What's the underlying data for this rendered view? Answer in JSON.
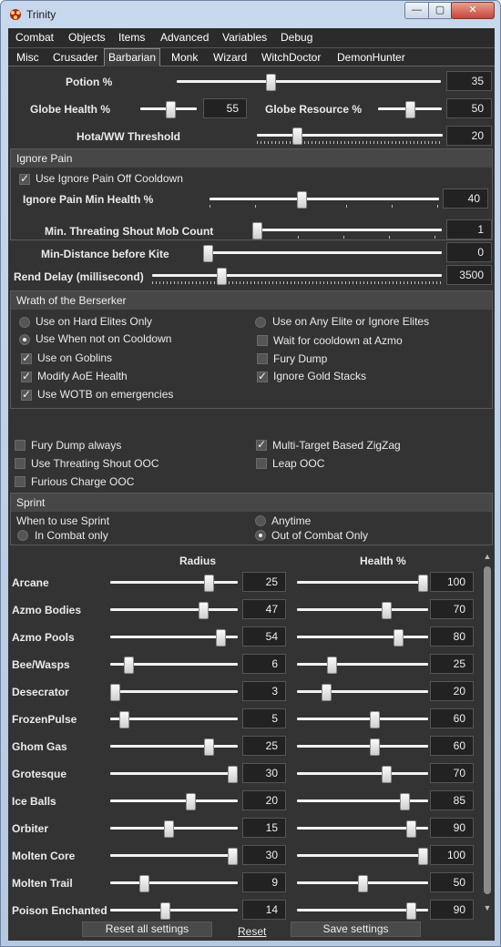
{
  "window": {
    "title": "Trinity"
  },
  "menu": [
    "Combat",
    "Objects",
    "Items",
    "Advanced",
    "Variables",
    "Debug"
  ],
  "tabs": [
    "Misc",
    "Crusader",
    "Barbarian",
    "Monk",
    "Wizard",
    "WitchDoctor",
    "DemonHunter"
  ],
  "active_tab": "Barbarian",
  "potion": {
    "label": "Potion %",
    "value": "35"
  },
  "globe_health": {
    "label": "Globe Health %",
    "value": "55"
  },
  "globe_resource": {
    "label": "Globe Resource %",
    "value": "50"
  },
  "hota": {
    "label": "Hota/WW Threshold",
    "value": "20"
  },
  "ignore_pain": {
    "header": "Ignore Pain",
    "use_off_cooldown": "Use Ignore Pain Off Cooldown",
    "min_health_label": "Ignore Pain Min Health %",
    "min_health_value": "40"
  },
  "threat_shout": {
    "label": "Min. Threating Shout Mob Count",
    "value": "1"
  },
  "kite": {
    "label": "Min-Distance before Kite",
    "value": "0"
  },
  "rend": {
    "label": "Rend Delay (millisecond)",
    "value": "3500"
  },
  "wotb": {
    "header": "Wrath of the Berserker",
    "hard_elites": "Use on Hard Elites Only",
    "any_elite": "Use on Any Elite or Ignore Elites",
    "not_on_cooldown": "Use When not on Cooldown",
    "wait_azmo": "Wait for cooldown at Azmo",
    "goblins": "Use on Goblins",
    "fury_dump": "Fury Dump",
    "modify_aoe": "Modify AoE Health",
    "ignore_gold": "Ignore Gold Stacks",
    "emergencies": "Use WOTB on emergencies"
  },
  "misc_checks": {
    "fury_dump_always": "Fury Dump always",
    "multi_target": "Multi-Target Based ZigZag",
    "threat_shout_ooc": "Use Threating Shout OOC",
    "leap_ooc": "Leap OOC",
    "furious_charge_ooc": "Furious Charge OOC"
  },
  "sprint": {
    "header": "Sprint",
    "when_label": "When to use Sprint",
    "anytime": "Anytime",
    "in_combat": "In Combat only",
    "out_of_combat": "Out of Combat Only"
  },
  "avoid": {
    "radius_header": "Radius",
    "health_header": "Health %",
    "rows": [
      {
        "name": "Arcane",
        "radius": "25",
        "health": "100",
        "rf": 0.8,
        "hf": 1.0
      },
      {
        "name": "Azmo Bodies",
        "radius": "47",
        "health": "70",
        "rf": 0.75,
        "hf": 0.7
      },
      {
        "name": "Azmo Pools",
        "radius": "54",
        "health": "80",
        "rf": 0.9,
        "hf": 0.8
      },
      {
        "name": "Bee/Wasps",
        "radius": "6",
        "health": "25",
        "rf": 0.12,
        "hf": 0.25
      },
      {
        "name": "Desecrator",
        "radius": "3",
        "health": "20",
        "rf": 0.0,
        "hf": 0.2
      },
      {
        "name": "FrozenPulse",
        "radius": "5",
        "health": "60",
        "rf": 0.08,
        "hf": 0.6
      },
      {
        "name": "Ghom Gas",
        "radius": "25",
        "health": "60",
        "rf": 0.8,
        "hf": 0.6
      },
      {
        "name": "Grotesque",
        "radius": "30",
        "health": "70",
        "rf": 1.0,
        "hf": 0.7
      },
      {
        "name": "Ice Balls",
        "radius": "20",
        "health": "85",
        "rf": 0.64,
        "hf": 0.85
      },
      {
        "name": "Orbiter",
        "radius": "15",
        "health": "90",
        "rf": 0.46,
        "hf": 0.9
      },
      {
        "name": "Molten Core",
        "radius": "30",
        "health": "100",
        "rf": 1.0,
        "hf": 1.0
      },
      {
        "name": "Molten Trail",
        "radius": "9",
        "health": "50",
        "rf": 0.25,
        "hf": 0.5
      },
      {
        "name": "Poison Enchanted",
        "radius": "14",
        "health": "90",
        "rf": 0.43,
        "hf": 0.9
      }
    ]
  },
  "footer": {
    "reset": "Reset",
    "reset_all": "Reset all settings",
    "save": "Save settings"
  },
  "slider_levels": {
    "potion": 0.35,
    "globe_health": 0.55,
    "globe_resource": 0.5,
    "hota": 0.2,
    "ignore_pain": 0.4,
    "threat_shout": 0.0,
    "kite": 0.0,
    "rend": 0.23
  }
}
